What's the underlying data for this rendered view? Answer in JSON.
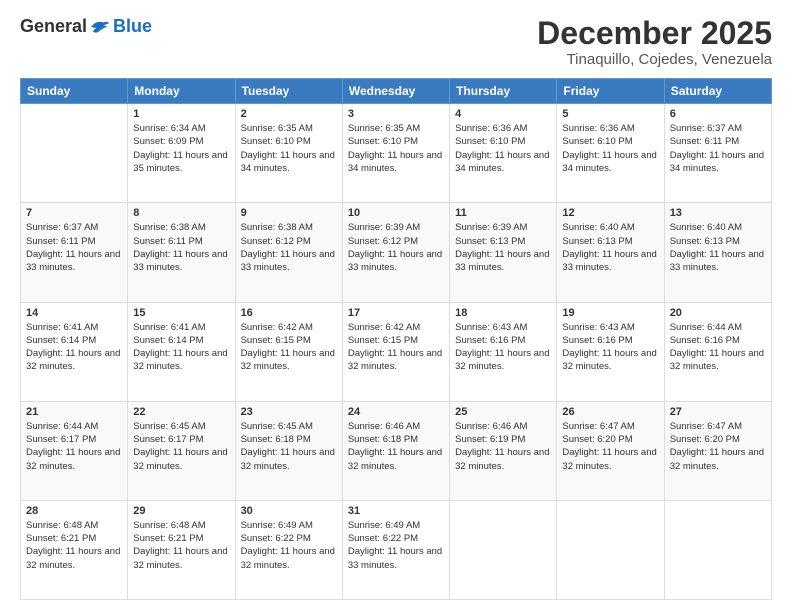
{
  "logo": {
    "general": "General",
    "blue": "Blue"
  },
  "header": {
    "month": "December 2025",
    "location": "Tinaquillo, Cojedes, Venezuela"
  },
  "weekdays": [
    "Sunday",
    "Monday",
    "Tuesday",
    "Wednesday",
    "Thursday",
    "Friday",
    "Saturday"
  ],
  "weeks": [
    [
      {
        "day": "",
        "sunrise": "",
        "sunset": "",
        "daylight": ""
      },
      {
        "day": "1",
        "sunrise": "Sunrise: 6:34 AM",
        "sunset": "Sunset: 6:09 PM",
        "daylight": "Daylight: 11 hours and 35 minutes."
      },
      {
        "day": "2",
        "sunrise": "Sunrise: 6:35 AM",
        "sunset": "Sunset: 6:10 PM",
        "daylight": "Daylight: 11 hours and 34 minutes."
      },
      {
        "day": "3",
        "sunrise": "Sunrise: 6:35 AM",
        "sunset": "Sunset: 6:10 PM",
        "daylight": "Daylight: 11 hours and 34 minutes."
      },
      {
        "day": "4",
        "sunrise": "Sunrise: 6:36 AM",
        "sunset": "Sunset: 6:10 PM",
        "daylight": "Daylight: 11 hours and 34 minutes."
      },
      {
        "day": "5",
        "sunrise": "Sunrise: 6:36 AM",
        "sunset": "Sunset: 6:10 PM",
        "daylight": "Daylight: 11 hours and 34 minutes."
      },
      {
        "day": "6",
        "sunrise": "Sunrise: 6:37 AM",
        "sunset": "Sunset: 6:11 PM",
        "daylight": "Daylight: 11 hours and 34 minutes."
      }
    ],
    [
      {
        "day": "7",
        "sunrise": "Sunrise: 6:37 AM",
        "sunset": "Sunset: 6:11 PM",
        "daylight": "Daylight: 11 hours and 33 minutes."
      },
      {
        "day": "8",
        "sunrise": "Sunrise: 6:38 AM",
        "sunset": "Sunset: 6:11 PM",
        "daylight": "Daylight: 11 hours and 33 minutes."
      },
      {
        "day": "9",
        "sunrise": "Sunrise: 6:38 AM",
        "sunset": "Sunset: 6:12 PM",
        "daylight": "Daylight: 11 hours and 33 minutes."
      },
      {
        "day": "10",
        "sunrise": "Sunrise: 6:39 AM",
        "sunset": "Sunset: 6:12 PM",
        "daylight": "Daylight: 11 hours and 33 minutes."
      },
      {
        "day": "11",
        "sunrise": "Sunrise: 6:39 AM",
        "sunset": "Sunset: 6:13 PM",
        "daylight": "Daylight: 11 hours and 33 minutes."
      },
      {
        "day": "12",
        "sunrise": "Sunrise: 6:40 AM",
        "sunset": "Sunset: 6:13 PM",
        "daylight": "Daylight: 11 hours and 33 minutes."
      },
      {
        "day": "13",
        "sunrise": "Sunrise: 6:40 AM",
        "sunset": "Sunset: 6:13 PM",
        "daylight": "Daylight: 11 hours and 33 minutes."
      }
    ],
    [
      {
        "day": "14",
        "sunrise": "Sunrise: 6:41 AM",
        "sunset": "Sunset: 6:14 PM",
        "daylight": "Daylight: 11 hours and 32 minutes."
      },
      {
        "day": "15",
        "sunrise": "Sunrise: 6:41 AM",
        "sunset": "Sunset: 6:14 PM",
        "daylight": "Daylight: 11 hours and 32 minutes."
      },
      {
        "day": "16",
        "sunrise": "Sunrise: 6:42 AM",
        "sunset": "Sunset: 6:15 PM",
        "daylight": "Daylight: 11 hours and 32 minutes."
      },
      {
        "day": "17",
        "sunrise": "Sunrise: 6:42 AM",
        "sunset": "Sunset: 6:15 PM",
        "daylight": "Daylight: 11 hours and 32 minutes."
      },
      {
        "day": "18",
        "sunrise": "Sunrise: 6:43 AM",
        "sunset": "Sunset: 6:16 PM",
        "daylight": "Daylight: 11 hours and 32 minutes."
      },
      {
        "day": "19",
        "sunrise": "Sunrise: 6:43 AM",
        "sunset": "Sunset: 6:16 PM",
        "daylight": "Daylight: 11 hours and 32 minutes."
      },
      {
        "day": "20",
        "sunrise": "Sunrise: 6:44 AM",
        "sunset": "Sunset: 6:16 PM",
        "daylight": "Daylight: 11 hours and 32 minutes."
      }
    ],
    [
      {
        "day": "21",
        "sunrise": "Sunrise: 6:44 AM",
        "sunset": "Sunset: 6:17 PM",
        "daylight": "Daylight: 11 hours and 32 minutes."
      },
      {
        "day": "22",
        "sunrise": "Sunrise: 6:45 AM",
        "sunset": "Sunset: 6:17 PM",
        "daylight": "Daylight: 11 hours and 32 minutes."
      },
      {
        "day": "23",
        "sunrise": "Sunrise: 6:45 AM",
        "sunset": "Sunset: 6:18 PM",
        "daylight": "Daylight: 11 hours and 32 minutes."
      },
      {
        "day": "24",
        "sunrise": "Sunrise: 6:46 AM",
        "sunset": "Sunset: 6:18 PM",
        "daylight": "Daylight: 11 hours and 32 minutes."
      },
      {
        "day": "25",
        "sunrise": "Sunrise: 6:46 AM",
        "sunset": "Sunset: 6:19 PM",
        "daylight": "Daylight: 11 hours and 32 minutes."
      },
      {
        "day": "26",
        "sunrise": "Sunrise: 6:47 AM",
        "sunset": "Sunset: 6:20 PM",
        "daylight": "Daylight: 11 hours and 32 minutes."
      },
      {
        "day": "27",
        "sunrise": "Sunrise: 6:47 AM",
        "sunset": "Sunset: 6:20 PM",
        "daylight": "Daylight: 11 hours and 32 minutes."
      }
    ],
    [
      {
        "day": "28",
        "sunrise": "Sunrise: 6:48 AM",
        "sunset": "Sunset: 6:21 PM",
        "daylight": "Daylight: 11 hours and 32 minutes."
      },
      {
        "day": "29",
        "sunrise": "Sunrise: 6:48 AM",
        "sunset": "Sunset: 6:21 PM",
        "daylight": "Daylight: 11 hours and 32 minutes."
      },
      {
        "day": "30",
        "sunrise": "Sunrise: 6:49 AM",
        "sunset": "Sunset: 6:22 PM",
        "daylight": "Daylight: 11 hours and 32 minutes."
      },
      {
        "day": "31",
        "sunrise": "Sunrise: 6:49 AM",
        "sunset": "Sunset: 6:22 PM",
        "daylight": "Daylight: 11 hours and 33 minutes."
      },
      {
        "day": "",
        "sunrise": "",
        "sunset": "",
        "daylight": ""
      },
      {
        "day": "",
        "sunrise": "",
        "sunset": "",
        "daylight": ""
      },
      {
        "day": "",
        "sunrise": "",
        "sunset": "",
        "daylight": ""
      }
    ]
  ]
}
